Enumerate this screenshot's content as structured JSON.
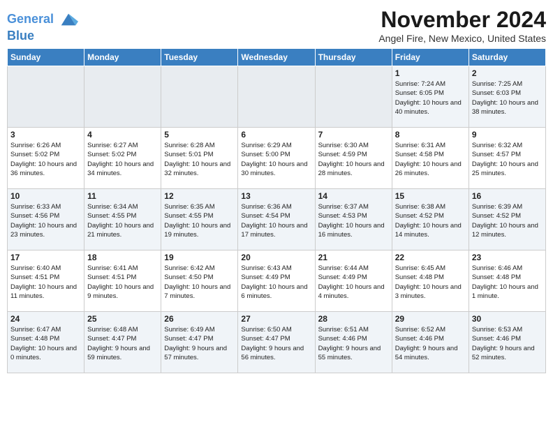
{
  "logo": {
    "line1": "General",
    "line2": "Blue"
  },
  "title": "November 2024",
  "location": "Angel Fire, New Mexico, United States",
  "days_of_week": [
    "Sunday",
    "Monday",
    "Tuesday",
    "Wednesday",
    "Thursday",
    "Friday",
    "Saturday"
  ],
  "weeks": [
    [
      {
        "day": "",
        "info": "",
        "empty": true
      },
      {
        "day": "",
        "info": "",
        "empty": true
      },
      {
        "day": "",
        "info": "",
        "empty": true
      },
      {
        "day": "",
        "info": "",
        "empty": true
      },
      {
        "day": "",
        "info": "",
        "empty": true
      },
      {
        "day": "1",
        "info": "Sunrise: 7:24 AM\nSunset: 6:05 PM\nDaylight: 10 hours and 40 minutes."
      },
      {
        "day": "2",
        "info": "Sunrise: 7:25 AM\nSunset: 6:03 PM\nDaylight: 10 hours and 38 minutes."
      }
    ],
    [
      {
        "day": "3",
        "info": "Sunrise: 6:26 AM\nSunset: 5:02 PM\nDaylight: 10 hours and 36 minutes."
      },
      {
        "day": "4",
        "info": "Sunrise: 6:27 AM\nSunset: 5:02 PM\nDaylight: 10 hours and 34 minutes."
      },
      {
        "day": "5",
        "info": "Sunrise: 6:28 AM\nSunset: 5:01 PM\nDaylight: 10 hours and 32 minutes."
      },
      {
        "day": "6",
        "info": "Sunrise: 6:29 AM\nSunset: 5:00 PM\nDaylight: 10 hours and 30 minutes."
      },
      {
        "day": "7",
        "info": "Sunrise: 6:30 AM\nSunset: 4:59 PM\nDaylight: 10 hours and 28 minutes."
      },
      {
        "day": "8",
        "info": "Sunrise: 6:31 AM\nSunset: 4:58 PM\nDaylight: 10 hours and 26 minutes."
      },
      {
        "day": "9",
        "info": "Sunrise: 6:32 AM\nSunset: 4:57 PM\nDaylight: 10 hours and 25 minutes."
      }
    ],
    [
      {
        "day": "10",
        "info": "Sunrise: 6:33 AM\nSunset: 4:56 PM\nDaylight: 10 hours and 23 minutes."
      },
      {
        "day": "11",
        "info": "Sunrise: 6:34 AM\nSunset: 4:55 PM\nDaylight: 10 hours and 21 minutes."
      },
      {
        "day": "12",
        "info": "Sunrise: 6:35 AM\nSunset: 4:55 PM\nDaylight: 10 hours and 19 minutes."
      },
      {
        "day": "13",
        "info": "Sunrise: 6:36 AM\nSunset: 4:54 PM\nDaylight: 10 hours and 17 minutes."
      },
      {
        "day": "14",
        "info": "Sunrise: 6:37 AM\nSunset: 4:53 PM\nDaylight: 10 hours and 16 minutes."
      },
      {
        "day": "15",
        "info": "Sunrise: 6:38 AM\nSunset: 4:52 PM\nDaylight: 10 hours and 14 minutes."
      },
      {
        "day": "16",
        "info": "Sunrise: 6:39 AM\nSunset: 4:52 PM\nDaylight: 10 hours and 12 minutes."
      }
    ],
    [
      {
        "day": "17",
        "info": "Sunrise: 6:40 AM\nSunset: 4:51 PM\nDaylight: 10 hours and 11 minutes."
      },
      {
        "day": "18",
        "info": "Sunrise: 6:41 AM\nSunset: 4:51 PM\nDaylight: 10 hours and 9 minutes."
      },
      {
        "day": "19",
        "info": "Sunrise: 6:42 AM\nSunset: 4:50 PM\nDaylight: 10 hours and 7 minutes."
      },
      {
        "day": "20",
        "info": "Sunrise: 6:43 AM\nSunset: 4:49 PM\nDaylight: 10 hours and 6 minutes."
      },
      {
        "day": "21",
        "info": "Sunrise: 6:44 AM\nSunset: 4:49 PM\nDaylight: 10 hours and 4 minutes."
      },
      {
        "day": "22",
        "info": "Sunrise: 6:45 AM\nSunset: 4:48 PM\nDaylight: 10 hours and 3 minutes."
      },
      {
        "day": "23",
        "info": "Sunrise: 6:46 AM\nSunset: 4:48 PM\nDaylight: 10 hours and 1 minute."
      }
    ],
    [
      {
        "day": "24",
        "info": "Sunrise: 6:47 AM\nSunset: 4:48 PM\nDaylight: 10 hours and 0 minutes."
      },
      {
        "day": "25",
        "info": "Sunrise: 6:48 AM\nSunset: 4:47 PM\nDaylight: 9 hours and 59 minutes."
      },
      {
        "day": "26",
        "info": "Sunrise: 6:49 AM\nSunset: 4:47 PM\nDaylight: 9 hours and 57 minutes."
      },
      {
        "day": "27",
        "info": "Sunrise: 6:50 AM\nSunset: 4:47 PM\nDaylight: 9 hours and 56 minutes."
      },
      {
        "day": "28",
        "info": "Sunrise: 6:51 AM\nSunset: 4:46 PM\nDaylight: 9 hours and 55 minutes."
      },
      {
        "day": "29",
        "info": "Sunrise: 6:52 AM\nSunset: 4:46 PM\nDaylight: 9 hours and 54 minutes."
      },
      {
        "day": "30",
        "info": "Sunrise: 6:53 AM\nSunset: 4:46 PM\nDaylight: 9 hours and 52 minutes."
      }
    ]
  ]
}
